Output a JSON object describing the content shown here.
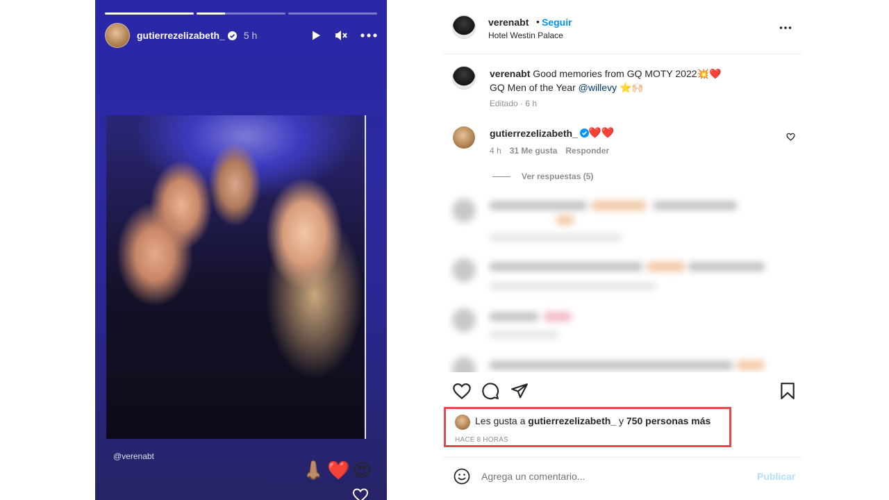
{
  "story": {
    "username": "gutierrezelizabeth_",
    "time": "5 h",
    "progress": [
      1.0,
      0.32,
      0.0
    ],
    "mention": "@verenabt",
    "emojis": [
      "👃🏽",
      "❤️",
      "😍"
    ],
    "icons": {
      "play": "play-icon",
      "mute": "mute-icon",
      "more": "more-icon",
      "verified": "verified-icon",
      "heart": "heart-icon"
    }
  },
  "post": {
    "username": "verenabt",
    "separator": "•",
    "follow": "Seguir",
    "location": "Hotel Westin Palace",
    "caption": {
      "username": "verenabt",
      "text_line1": "Good memories from GQ MOTY 2022💥❤️",
      "text_line2_prefix": "GQ Men of the Year",
      "mention": "@willevy",
      "text_line2_suffix": "⭐🙌🏻",
      "meta": "Editado · 6 h"
    },
    "comment": {
      "username": "gutierrezelizabeth_",
      "text": "❤️❤️",
      "time": "4 h",
      "likes": "31 Me gusta",
      "reply": "Responder"
    },
    "view_replies": "Ver respuestas (5)",
    "likes": {
      "prefix": "Les gusta a",
      "user": "gutierrezelizabeth_",
      "middle": "y",
      "others": "750 personas más",
      "time": "HACE 8 HORAS"
    },
    "add_comment_placeholder": "Agrega un comentario...",
    "publish": "Publicar",
    "highlight_color": "#e04a4a",
    "link_color": "#0095f6"
  }
}
